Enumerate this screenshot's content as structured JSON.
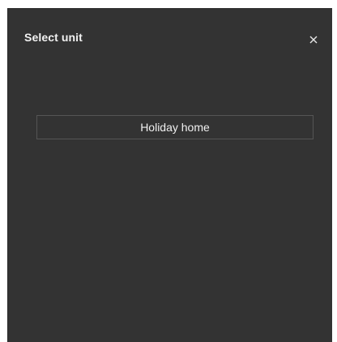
{
  "dialog": {
    "title": "Select unit",
    "close_icon": "close-icon"
  },
  "units": [
    {
      "label": "Holiday home"
    }
  ],
  "colors": {
    "dialog_background": "#333333",
    "text": "#f0f0f0",
    "option_border": "#555555"
  }
}
